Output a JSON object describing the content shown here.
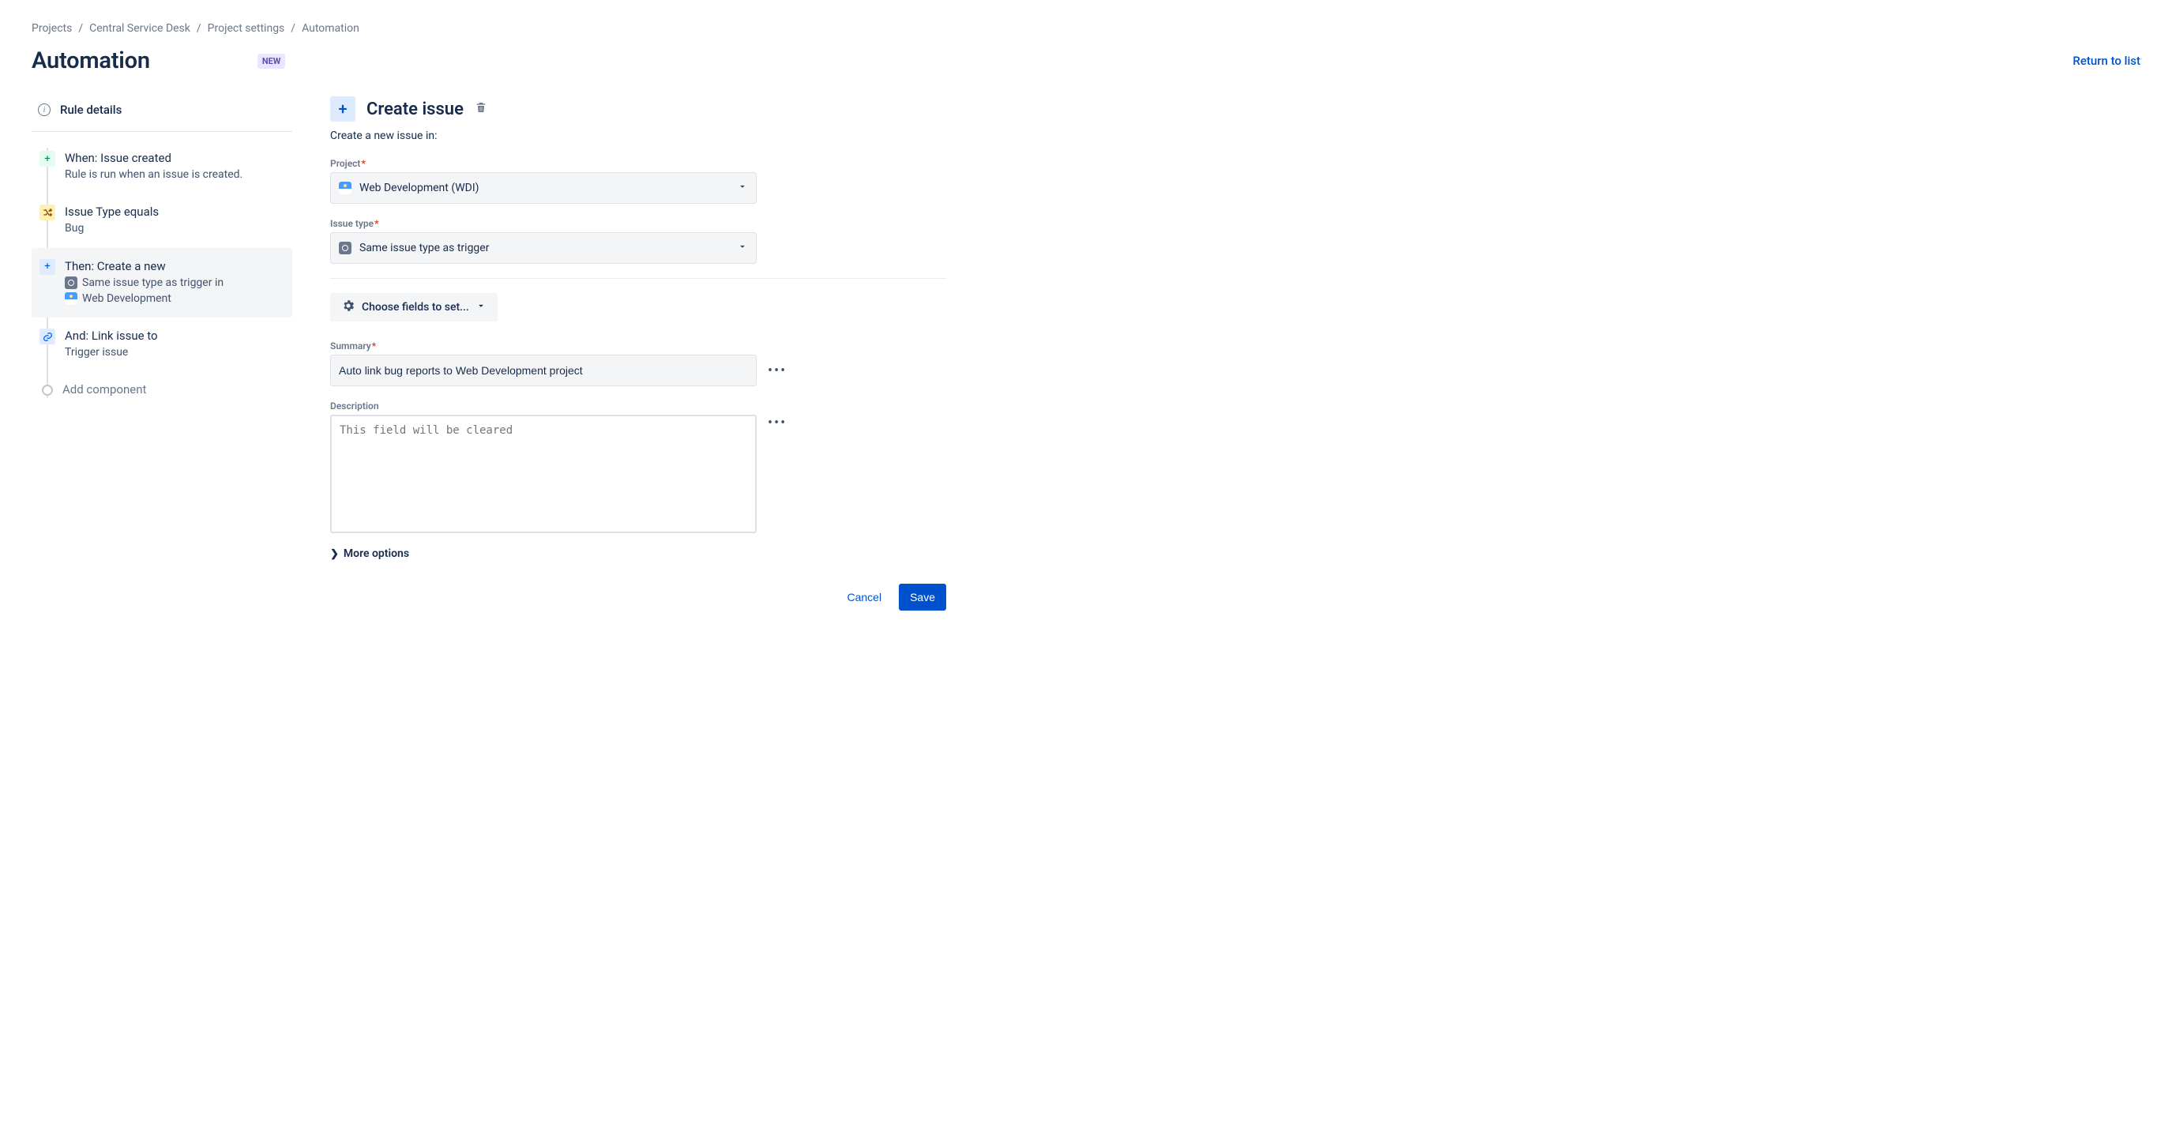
{
  "breadcrumb": [
    "Projects",
    "Central Service Desk",
    "Project settings",
    "Automation"
  ],
  "header": {
    "title": "Automation",
    "new_badge": "NEW",
    "return": "Return to list"
  },
  "sidebar": {
    "rule_details": "Rule details",
    "steps": [
      {
        "title": "When: Issue created",
        "sub": "Rule is run when an issue is created."
      },
      {
        "title": "Issue Type equals",
        "sub": "Bug"
      },
      {
        "title": "Then: Create a new",
        "sub_pre": "Same issue type as trigger in",
        "sub_post": "Web Development"
      },
      {
        "title": "And: Link issue to",
        "sub": "Trigger issue"
      }
    ],
    "add": "Add component"
  },
  "panel": {
    "title": "Create issue",
    "subtitle": "Create a new issue in:",
    "project_label": "Project",
    "project_value": "Web Development (WDI)",
    "issue_type_label": "Issue type",
    "issue_type_value": "Same issue type as trigger",
    "choose_fields": "Choose fields to set...",
    "summary_label": "Summary",
    "summary_value": "Auto link bug reports to Web Development project",
    "description_label": "Description",
    "description_placeholder": "This field will be cleared",
    "more_options": "More options",
    "cancel": "Cancel",
    "save": "Save"
  }
}
